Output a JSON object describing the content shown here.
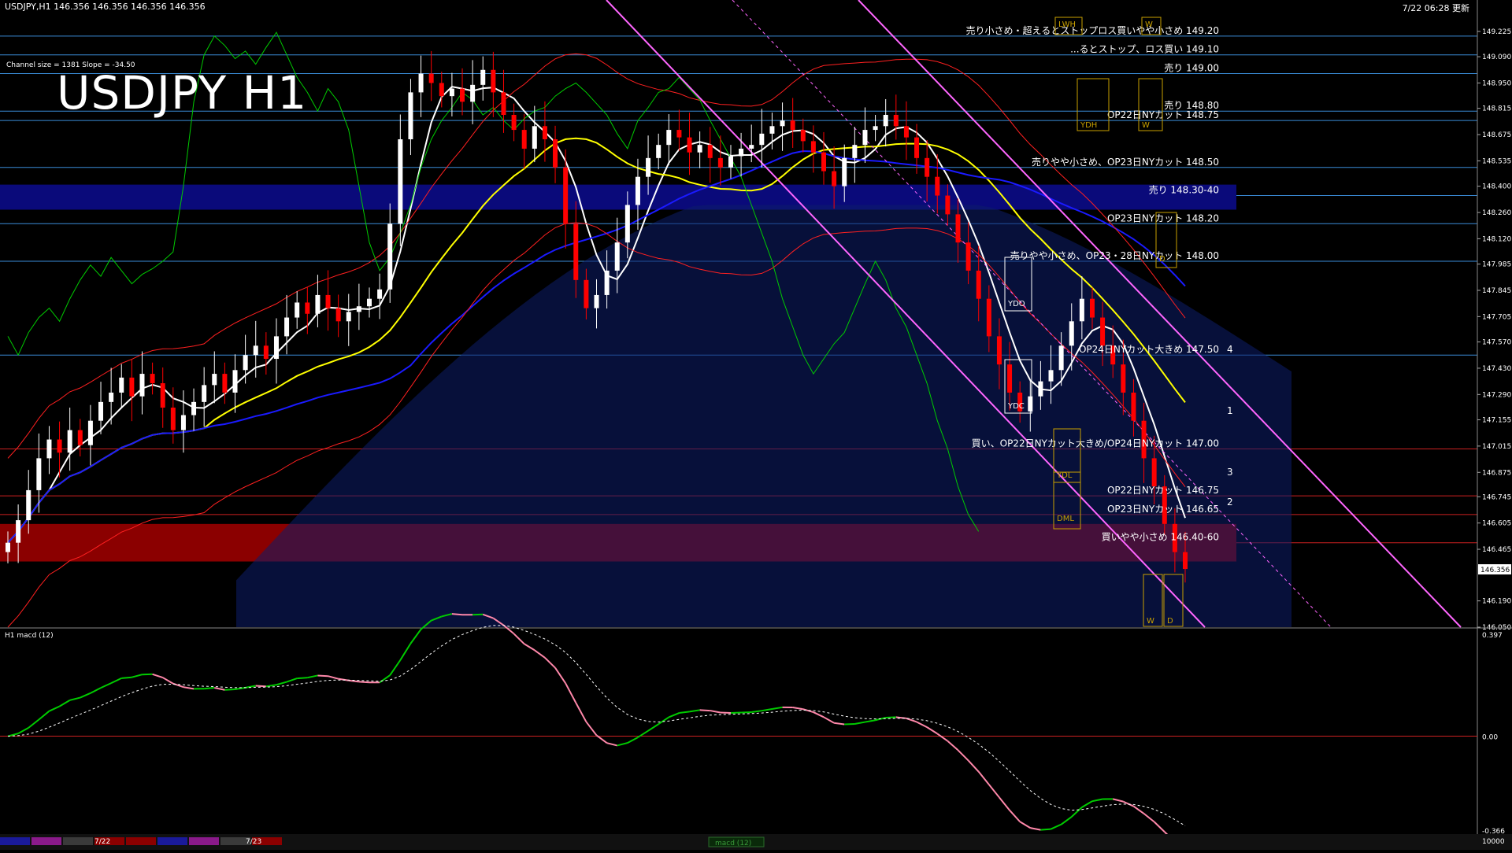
{
  "header": {
    "symbol_info": "USDJPY,H1  146.356 146.356 146.356 146.356",
    "updated": "7/22 06:28 更新",
    "channel_info": "Channel size = 1381 Slope = -34.50",
    "title": "USDJPY H1"
  },
  "price_axis": {
    "min": 146.05,
    "max": 149.3,
    "ticks": [
      "149.225",
      "149.090",
      "148.950",
      "148.815",
      "148.675",
      "148.535",
      "148.400",
      "148.260",
      "148.120",
      "147.985",
      "147.845",
      "147.705",
      "147.570",
      "147.430",
      "147.290",
      "147.155",
      "147.015",
      "146.875",
      "146.745",
      "146.605",
      "146.465",
      "146.190",
      "146.050"
    ],
    "current": "146.356",
    "current_value": 146.356
  },
  "macd": {
    "label": "H1  macd (12)",
    "ticks": [
      "0.397",
      "0.00",
      "-0.366"
    ],
    "max": 0.397,
    "min": -0.366
  },
  "levels": [
    {
      "label": "売り小さめ・超えるとストップロス買いやや小さめ 149.20",
      "price": 149.2
    },
    {
      "label": "...るとストップ、ロス買い 149.10",
      "price": 149.1
    },
    {
      "label": "売り 149.00",
      "price": 149.0
    },
    {
      "label": "売り 148.80",
      "price": 148.8
    },
    {
      "label": "OP22日NYカット 148.75",
      "price": 148.75
    },
    {
      "label": "売りやや小さめ、OP23日NYカット 148.50",
      "price": 148.5
    },
    {
      "label": "売り 148.30-40",
      "price": 148.35
    },
    {
      "label": "OP23日NYカット 148.20",
      "price": 148.2
    },
    {
      "label": "売りやや小さめ、OP23・28日NYカット 148.00",
      "price": 148.0
    },
    {
      "label": "OP24日NYカット大きめ 147.50",
      "price": 147.5
    },
    {
      "label": "買い、OP22日NYカット大きめ/OP24日NYカット 147.00",
      "price": 147.0
    },
    {
      "label": "OP22日NYカット 146.75",
      "price": 146.75
    },
    {
      "label": "OP23日NYカット 146.65",
      "price": 146.65
    },
    {
      "label": "買いやや小さめ 146.40-60",
      "price": 146.5
    }
  ],
  "zone_labels": [
    "YDH",
    "W",
    "YDO",
    "YDC",
    "YDL",
    "DML",
    "D",
    "W",
    "D",
    "LWH",
    "W"
  ],
  "channel_numbers": [
    "4",
    "1",
    "3",
    "2"
  ],
  "bottom_bar": {
    "dates": [
      "7/22",
      "7/23"
    ],
    "tab": "macd (12)",
    "right_value": "10000"
  },
  "colors": {
    "background": "#000000",
    "sell_band": "#0a0a7a",
    "buy_band": "#8b0000",
    "level_line": "#3a8cd8",
    "red_line": "#cc2020",
    "ma_white": "#ffffff",
    "ma_yellow": "#ffff00",
    "ma_blue": "#1a1aff",
    "channel": "#ff66ff",
    "bollinger": "#ff2020",
    "chikou": "#00cc00",
    "macd_fast_up": "#00cc00",
    "macd_fast_down": "#ff88aa",
    "macd_signal": "#ffffff",
    "candle_up": "#ffffff",
    "candle_down": "#ff0000"
  },
  "chart_data": {
    "type": "candlestick",
    "symbol": "USDJPY",
    "timeframe": "H1",
    "ylim": [
      146.05,
      149.3
    ],
    "closes": [
      146.5,
      146.62,
      146.78,
      146.95,
      147.05,
      146.98,
      147.1,
      147.02,
      147.15,
      147.25,
      147.3,
      147.38,
      147.28,
      147.4,
      147.35,
      147.22,
      147.1,
      147.18,
      147.25,
      147.34,
      147.4,
      147.3,
      147.42,
      147.5,
      147.55,
      147.48,
      147.6,
      147.7,
      147.78,
      147.72,
      147.82,
      147.75,
      147.68,
      147.73,
      147.76,
      147.8,
      147.85,
      148.2,
      148.65,
      148.9,
      149.0,
      148.95,
      148.88,
      148.92,
      148.85,
      148.94,
      149.02,
      148.9,
      148.78,
      148.7,
      148.6,
      148.72,
      148.65,
      148.5,
      148.2,
      147.9,
      147.75,
      147.82,
      147.95,
      148.1,
      148.3,
      148.45,
      148.55,
      148.62,
      148.7,
      148.66,
      148.58,
      148.62,
      148.55,
      148.5,
      148.56,
      148.6,
      148.62,
      148.68,
      148.72,
      148.75,
      148.7,
      148.64,
      148.58,
      148.48,
      148.4,
      148.55,
      148.62,
      148.7,
      148.72,
      148.78,
      148.72,
      148.66,
      148.55,
      148.45,
      148.35,
      148.25,
      148.1,
      147.95,
      147.8,
      147.6,
      147.45,
      147.3,
      147.2,
      147.28,
      147.36,
      147.42,
      147.55,
      147.68,
      147.8,
      147.7,
      147.55,
      147.45,
      147.3,
      147.15,
      146.95,
      146.8,
      146.6,
      146.45,
      146.36
    ],
    "bands": {
      "sell": [
        148.3,
        148.4
      ],
      "buy": [
        146.4,
        146.6
      ]
    }
  }
}
